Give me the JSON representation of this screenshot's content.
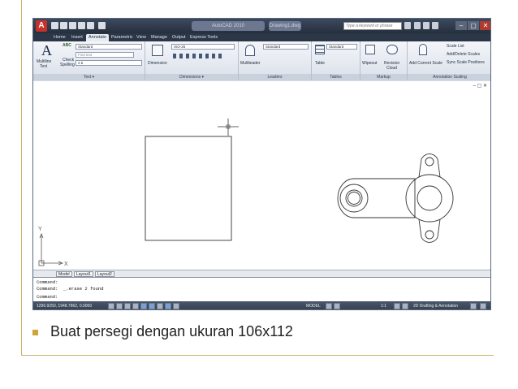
{
  "window": {
    "title": "Drawing1.dwg",
    "app": "AutoCAD 2010"
  },
  "search": {
    "placeholder": "Type a keyword or phrase"
  },
  "tabs": [
    {
      "label": "Home",
      "active": false
    },
    {
      "label": "Insert",
      "active": false
    },
    {
      "label": "Annotate",
      "active": true
    },
    {
      "label": "Parametric",
      "active": false
    },
    {
      "label": "View",
      "active": false
    },
    {
      "label": "Manage",
      "active": false
    },
    {
      "label": "Output",
      "active": false
    },
    {
      "label": "Express Tools",
      "active": false
    }
  ],
  "ribbon": {
    "text_panel": {
      "title": "Text ▾",
      "multiline": "Multiline",
      "multiline2": "Text",
      "check": "Check",
      "spelling": "Spelling",
      "style": "Standard",
      "font": "Find text",
      "height": "2.5",
      "big_letter": "A",
      "abc": "ABC"
    },
    "dim_panel": {
      "title": "Dimensions ▾",
      "dimension": "Dimension",
      "style": "ISO-25"
    },
    "leaders_panel": {
      "title": "Leaders",
      "multileader": "Multileader",
      "style": "Standard"
    },
    "tables_panel": {
      "title": "Tables",
      "table": "Table",
      "style": "Standard"
    },
    "markup_panel": {
      "title": "Markup",
      "wipeout": "Wipeout",
      "revision": "Revision",
      "cloud": "Cloud"
    },
    "scaling_panel": {
      "title": "Annotation Scaling",
      "add_current": "Add Current Scale",
      "scale_list": "Scale List",
      "add_delete": "Add/Delete Scales",
      "sync": "Sync Scale Positions"
    }
  },
  "drawing": {
    "axis_x": "X",
    "axis_y": "Y",
    "ctrls": "– ▢ ✕"
  },
  "layout_tabs": [
    "Model",
    "Layout1",
    "Layout2"
  ],
  "command_lines": [
    "Command:",
    "Command:  _.erase 2 found",
    "Command:"
  ],
  "status": {
    "coords": "1296.9250, 1948.7862, 0.0000",
    "model_label": "MODEL",
    "scale": "1:1",
    "workspace": "2D Drafting & Annotation"
  },
  "caption": {
    "text": "Buat persegi dengan ukuran 106x112"
  },
  "colors": {
    "bullet": "#cfa23a",
    "titlebar": "#2b3646",
    "ribbon": "#e4e9f0"
  }
}
